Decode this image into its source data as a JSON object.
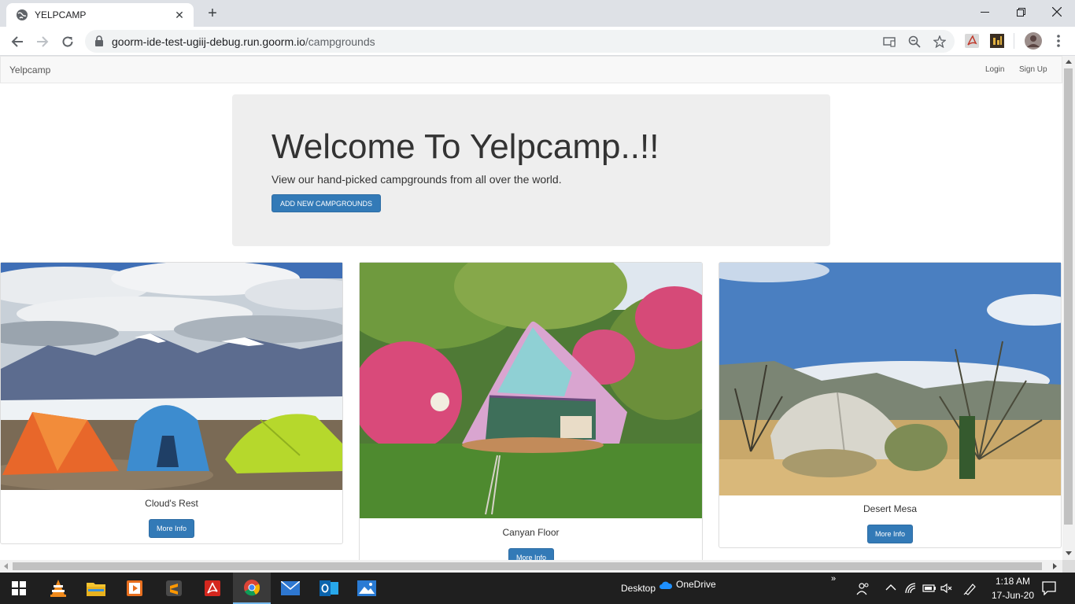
{
  "browser": {
    "tab_title": "YELPCAMP",
    "url_host": "goorm-ide-test-ugiij-debug.run.goorm.io",
    "url_path": "/campgrounds"
  },
  "site": {
    "brand": "Yelpcamp",
    "nav_login": "Login",
    "nav_signup": "Sign Up"
  },
  "jumbotron": {
    "heading": "Welcome To Yelpcamp..!!",
    "lead": "View our hand-picked campgrounds from all over the world.",
    "button_label": "ADD NEW CAMPGROUNDS"
  },
  "campgrounds": [
    {
      "name": "Cloud's Rest",
      "button_label": "More Info"
    },
    {
      "name": "Canyan Floor",
      "button_label": "More Info"
    },
    {
      "name": "Desert Mesa",
      "button_label": "More Info"
    }
  ],
  "taskbar": {
    "desktop_label": "Desktop",
    "onedrive_label": "OneDrive",
    "time": "1:18 AM",
    "date": "17-Jun-20"
  },
  "colors": {
    "primary": "#337ab7",
    "taskbar": "#1f1f1f"
  }
}
